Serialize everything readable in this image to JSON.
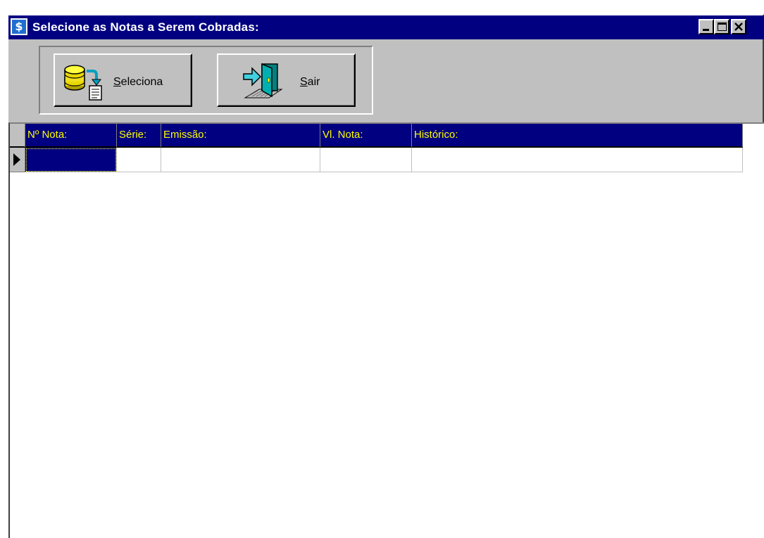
{
  "window": {
    "title": "Selecione as Notas a Serem Cobradas:",
    "icon": "dollar-icon",
    "icon_glyph": "$",
    "controls": [
      "minimize",
      "maximize",
      "close"
    ]
  },
  "toolbar": {
    "seleciona": {
      "mnemonic": "S",
      "rest": "eleciona",
      "icon": "database-to-document-icon"
    },
    "sair": {
      "mnemonic": "S",
      "rest": "air",
      "icon": "exit-door-icon"
    }
  },
  "grid": {
    "columns": [
      "Nº Nota:",
      "Série:",
      "Emissão:",
      "Vl. Nota:",
      "Histórico:"
    ],
    "rows": [
      [
        "",
        "",
        "",
        "",
        ""
      ]
    ],
    "header_color": "#000080",
    "header_text_color": "#ffff00"
  }
}
